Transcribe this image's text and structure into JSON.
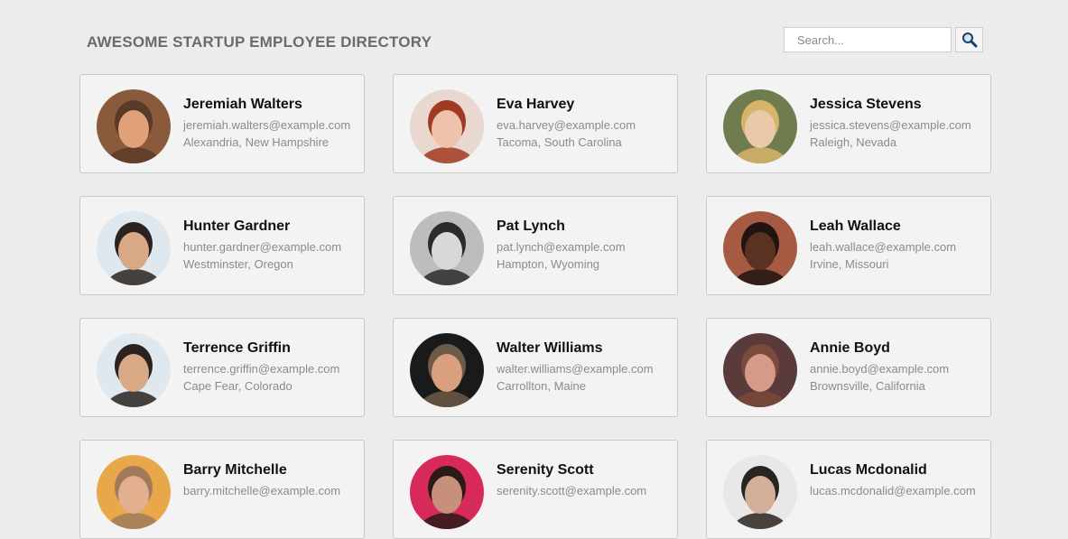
{
  "header": {
    "title": "AWESOME STARTUP EMPLOYEE DIRECTORY"
  },
  "search": {
    "placeholder": "Search...",
    "button_icon": "search-icon"
  },
  "employees": [
    {
      "name": "Jeremiah Walters",
      "email": "jeremiah.walters@example.com",
      "location": "Alexandria, New Hampshire",
      "avatar_bg": "#8a5a3c",
      "avatar_fg": "#e0a07a",
      "hair": "#5a3a28"
    },
    {
      "name": "Eva Harvey",
      "email": "eva.harvey@example.com",
      "location": "Tacoma, South Carolina",
      "avatar_bg": "#e8d8d0",
      "avatar_fg": "#efc2ab",
      "hair": "#a13a22"
    },
    {
      "name": "Jessica Stevens",
      "email": "jessica.stevens@example.com",
      "location": "Raleigh, Nevada",
      "avatar_bg": "#6e7c4e",
      "avatar_fg": "#e9c9a8",
      "hair": "#d8b46a"
    },
    {
      "name": "Hunter Gardner",
      "email": "hunter.gardner@example.com",
      "location": "Westminster, Oregon",
      "avatar_bg": "#dfe8ee",
      "avatar_fg": "#d9a885",
      "hair": "#2a2320"
    },
    {
      "name": "Pat Lynch",
      "email": "pat.lynch@example.com",
      "location": "Hampton, Wyoming",
      "avatar_bg": "#bdbdbd",
      "avatar_fg": "#d8d8d8",
      "hair": "#2b2b2b"
    },
    {
      "name": "Leah Wallace",
      "email": "leah.wallace@example.com",
      "location": "Irvine, Missouri",
      "avatar_bg": "#a65a42",
      "avatar_fg": "#5a3222",
      "hair": "#1f1410"
    },
    {
      "name": "Terrence Griffin",
      "email": "terrence.griffin@example.com",
      "location": "Cape Fear, Colorado",
      "avatar_bg": "#dfe8ee",
      "avatar_fg": "#d9a885",
      "hair": "#2a2320"
    },
    {
      "name": "Walter Williams",
      "email": "walter.williams@example.com",
      "location": "Carrollton, Maine",
      "avatar_bg": "#1a1a1a",
      "avatar_fg": "#d9a080",
      "hair": "#6e5a48"
    },
    {
      "name": "Annie Boyd",
      "email": "annie.boyd@example.com",
      "location": "Brownsville, California",
      "avatar_bg": "#5a3a3a",
      "avatar_fg": "#d59a8a",
      "hair": "#7a4a3a"
    },
    {
      "name": "Barry Mitchelle",
      "email": "barry.mitchelle@example.com",
      "location": "",
      "avatar_bg": "#e8a84a",
      "avatar_fg": "#e2b08e",
      "hair": "#a07a5a"
    },
    {
      "name": "Serenity Scott",
      "email": "serenity.scott@example.com",
      "location": "",
      "avatar_bg": "#d82a5a",
      "avatar_fg": "#c8907a",
      "hair": "#2a1a18"
    },
    {
      "name": "Lucas Mcdonalid",
      "email": "lucas.mcdonalid@example.com",
      "location": "",
      "avatar_bg": "#e8e8e8",
      "avatar_fg": "#d4b09a",
      "hair": "#2a2420"
    }
  ]
}
